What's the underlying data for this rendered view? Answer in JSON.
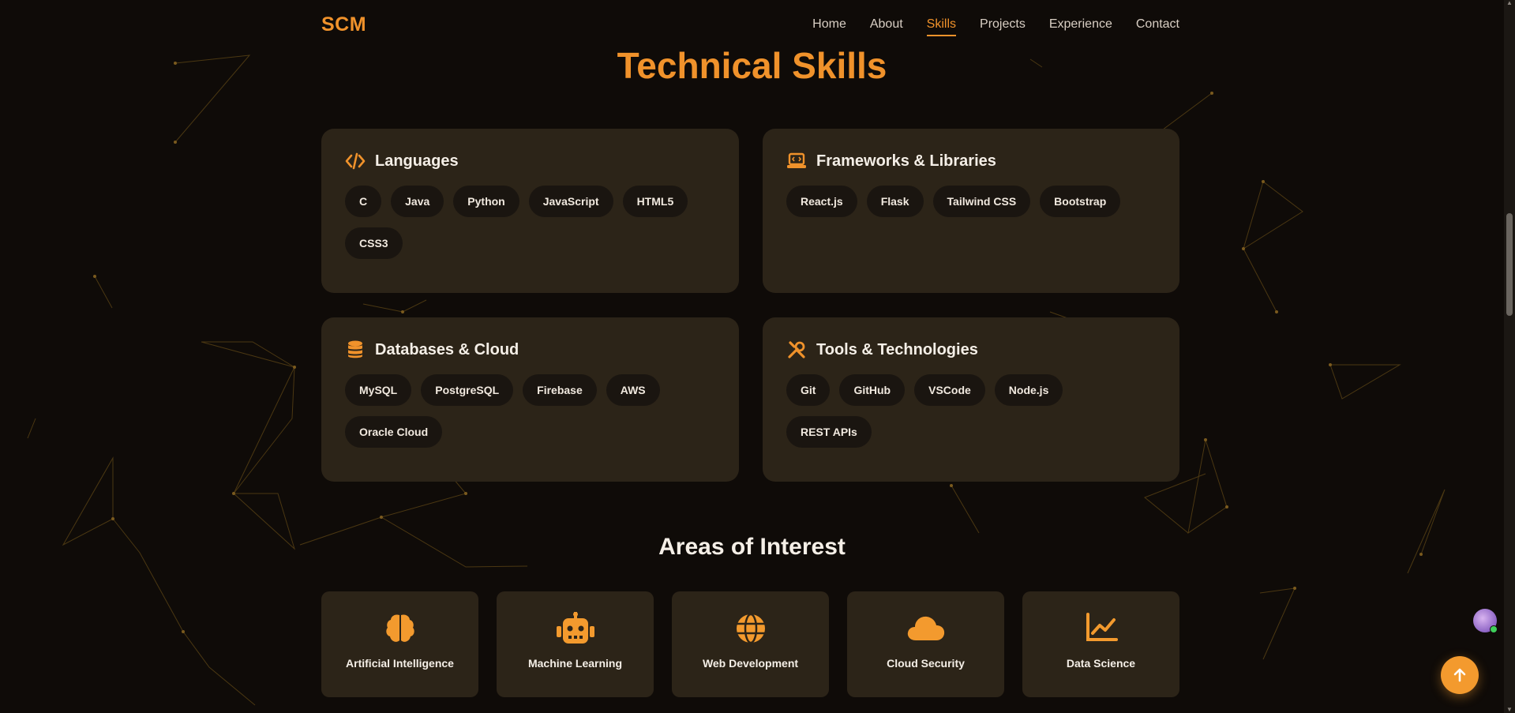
{
  "nav": {
    "logo": "SCM",
    "links": [
      "Home",
      "About",
      "Skills",
      "Projects",
      "Experience",
      "Contact"
    ],
    "active": "Skills"
  },
  "sections": {
    "technical_title": "Technical Skills",
    "interests_title": "Areas of Interest"
  },
  "skill_groups": [
    {
      "title": "Languages",
      "icon": "code-icon",
      "items": [
        "C",
        "Java",
        "Python",
        "JavaScript",
        "HTML5",
        "CSS3"
      ]
    },
    {
      "title": "Frameworks & Libraries",
      "icon": "laptop-code-icon",
      "items": [
        "React.js",
        "Flask",
        "Tailwind CSS",
        "Bootstrap"
      ]
    },
    {
      "title": "Databases & Cloud",
      "icon": "database-icon",
      "items": [
        "MySQL",
        "PostgreSQL",
        "Firebase",
        "AWS",
        "Oracle Cloud"
      ]
    },
    {
      "title": "Tools & Technologies",
      "icon": "tools-icon",
      "items": [
        "Git",
        "GitHub",
        "VSCode",
        "Node.js",
        "REST APIs"
      ]
    }
  ],
  "interests": [
    {
      "label": "Artificial Intelligence",
      "icon": "brain-icon"
    },
    {
      "label": "Machine Learning",
      "icon": "robot-icon"
    },
    {
      "label": "Web Development",
      "icon": "globe-icon"
    },
    {
      "label": "Cloud Security",
      "icon": "cloud-icon"
    },
    {
      "label": "Data Science",
      "icon": "chart-line-icon"
    }
  ],
  "colors": {
    "accent": "#f0922b",
    "background": "#0f0b08",
    "card": "#2c2418",
    "chip": "#1a1510"
  }
}
